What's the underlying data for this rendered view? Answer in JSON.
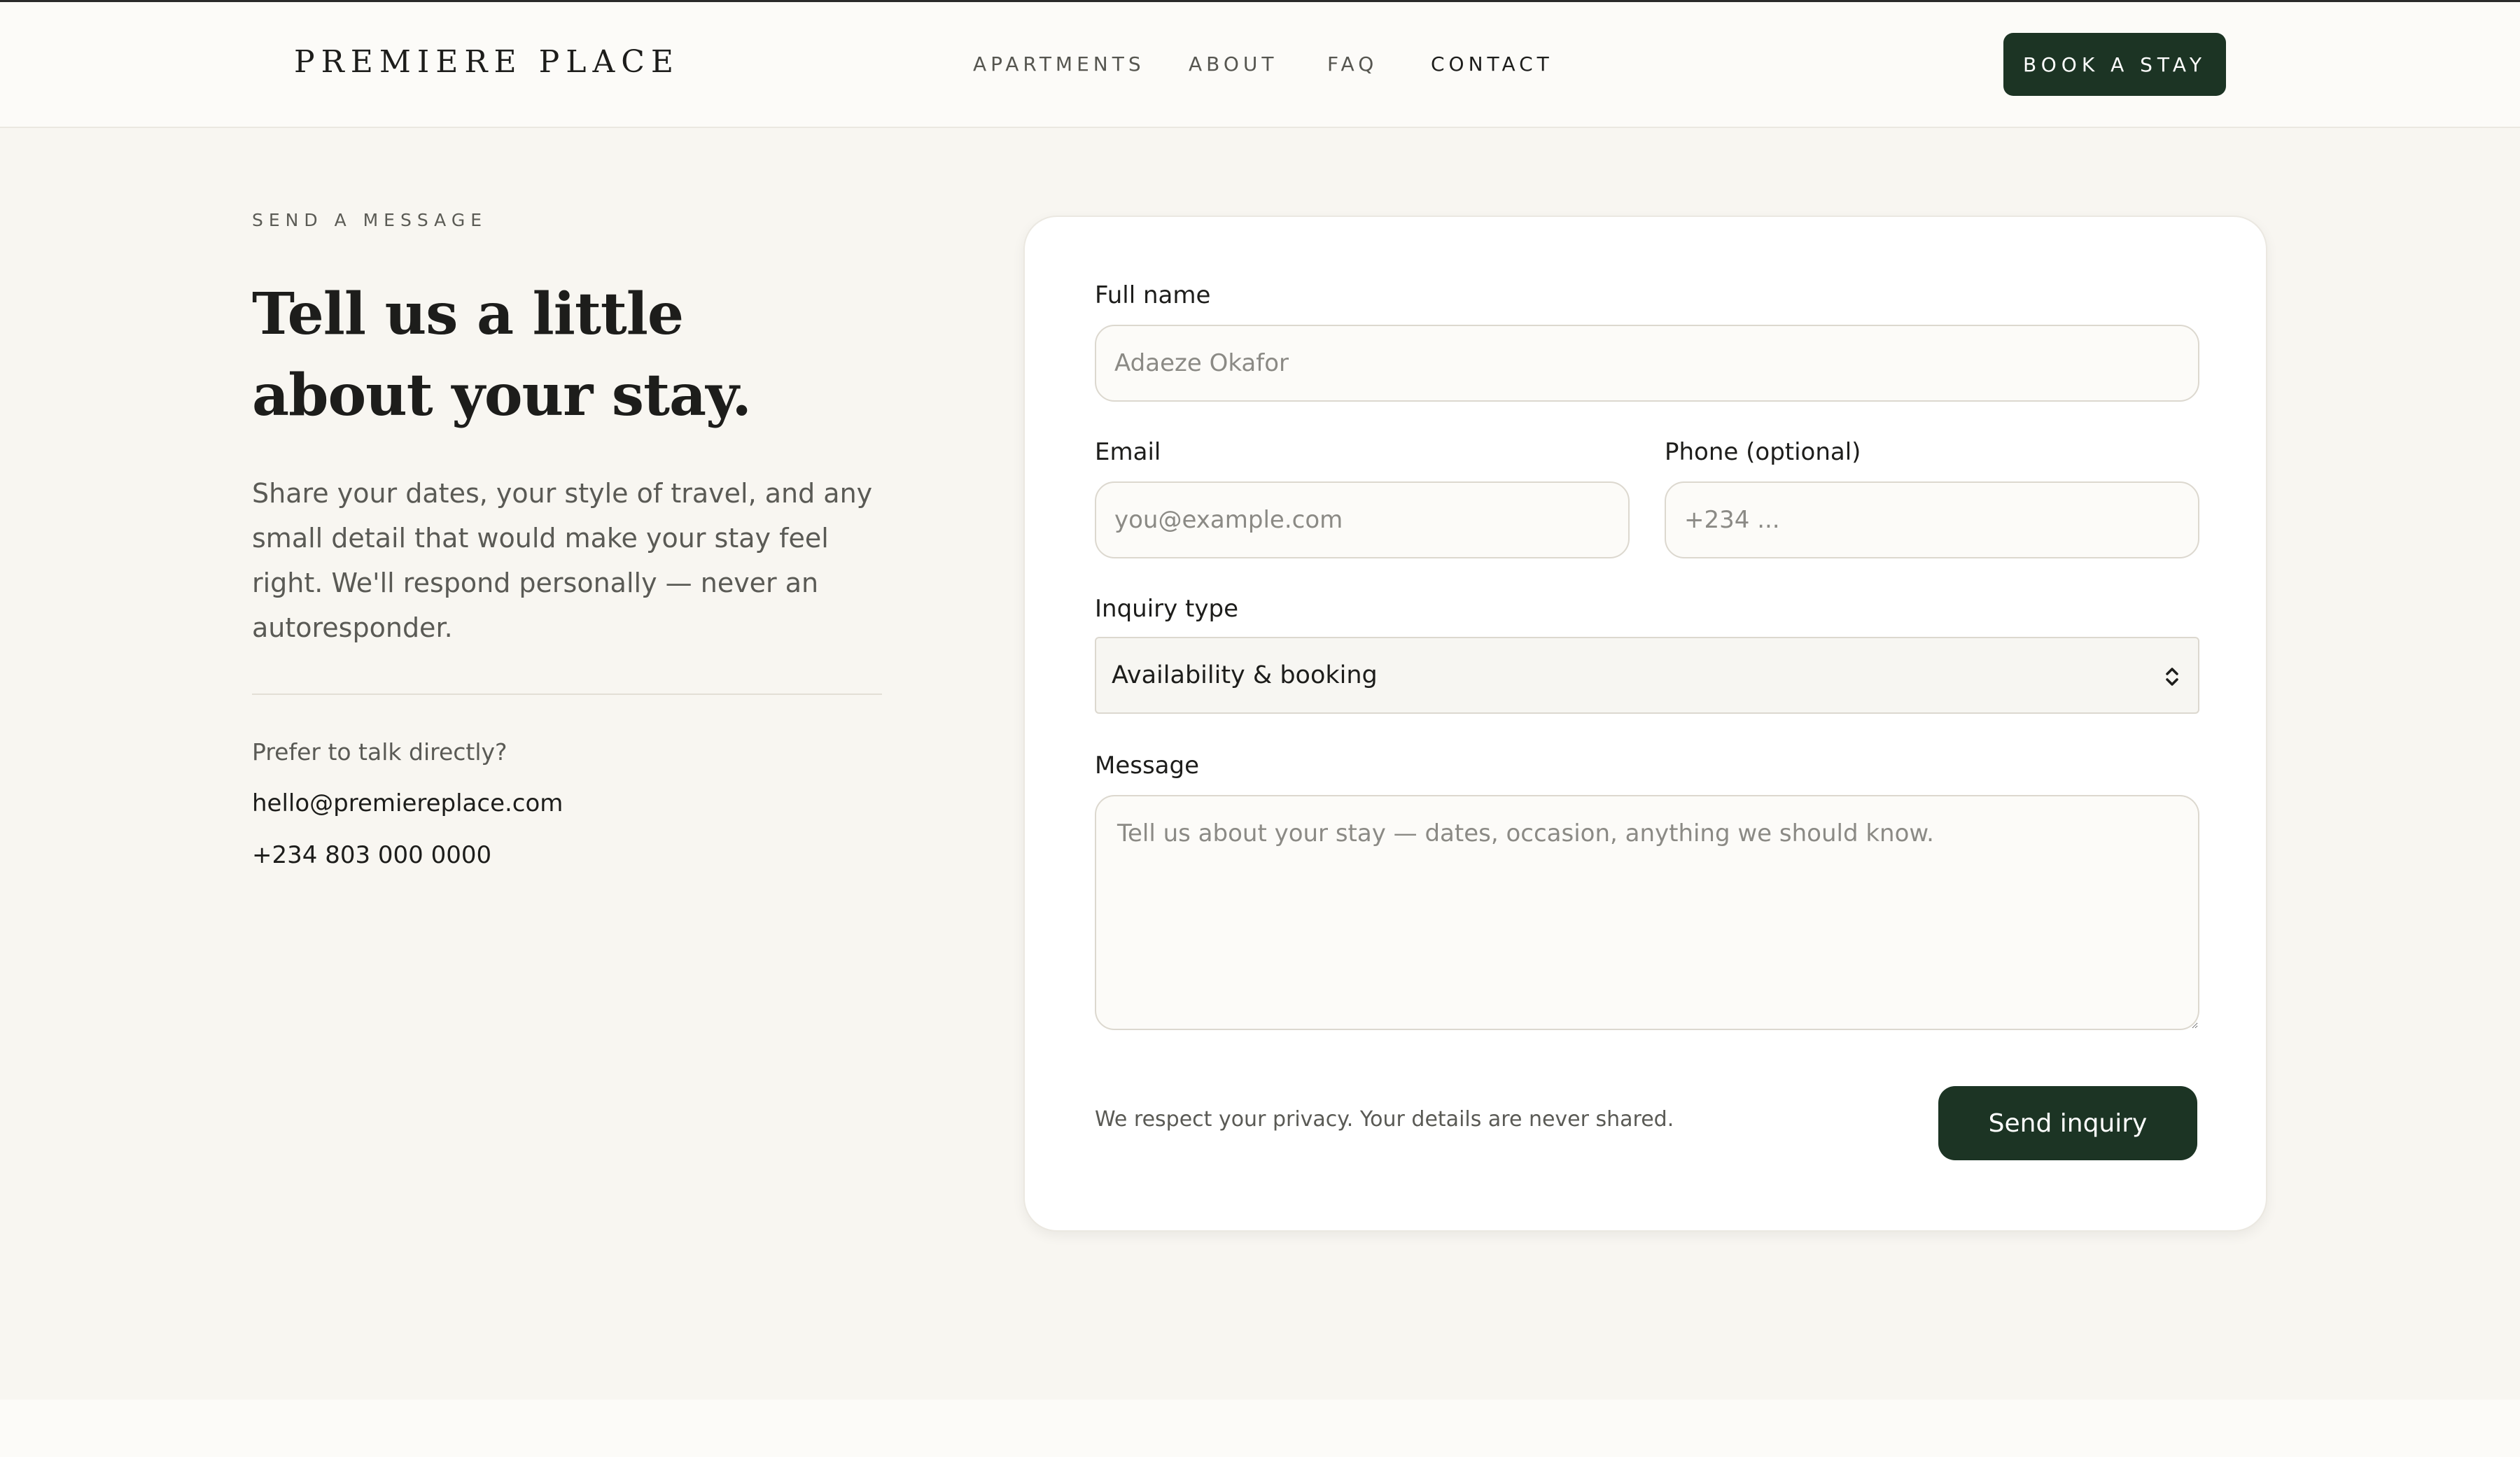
{
  "header": {
    "logo": "PREMIERE PLACE",
    "nav": [
      {
        "label": "APARTMENTS",
        "active": false
      },
      {
        "label": "ABOUT",
        "active": false
      },
      {
        "label": "FAQ",
        "active": false
      },
      {
        "label": "CONTACT",
        "active": true
      }
    ],
    "book_label": "BOOK A STAY"
  },
  "intro": {
    "eyebrow": "SEND A MESSAGE",
    "heading": "Tell us a little about your stay.",
    "body": "Share your dates, your style of travel, and any small detail that would make your stay feel right. We'll respond personally — never an autoresponder.",
    "prefer": "Prefer to talk directly?",
    "email": "hello@premiereplace.com",
    "phone": "+234 803 000 0000"
  },
  "form": {
    "full_name": {
      "label": "Full name",
      "placeholder": "Adaeze Okafor"
    },
    "email": {
      "label": "Email",
      "placeholder": "you@example.com"
    },
    "phone": {
      "label": "Phone (optional)",
      "placeholder": "+234 ..."
    },
    "inquiry": {
      "label": "Inquiry type",
      "selected": "Availability & booking"
    },
    "message": {
      "label": "Message",
      "placeholder": "Tell us about your stay — dates, occasion, anything we should know."
    },
    "privacy": "We respect your privacy. Your details are never shared.",
    "submit_label": "Send inquiry"
  },
  "colors": {
    "accent": "#1c3424",
    "background": "#f8f6f1",
    "card": "#ffffff"
  }
}
